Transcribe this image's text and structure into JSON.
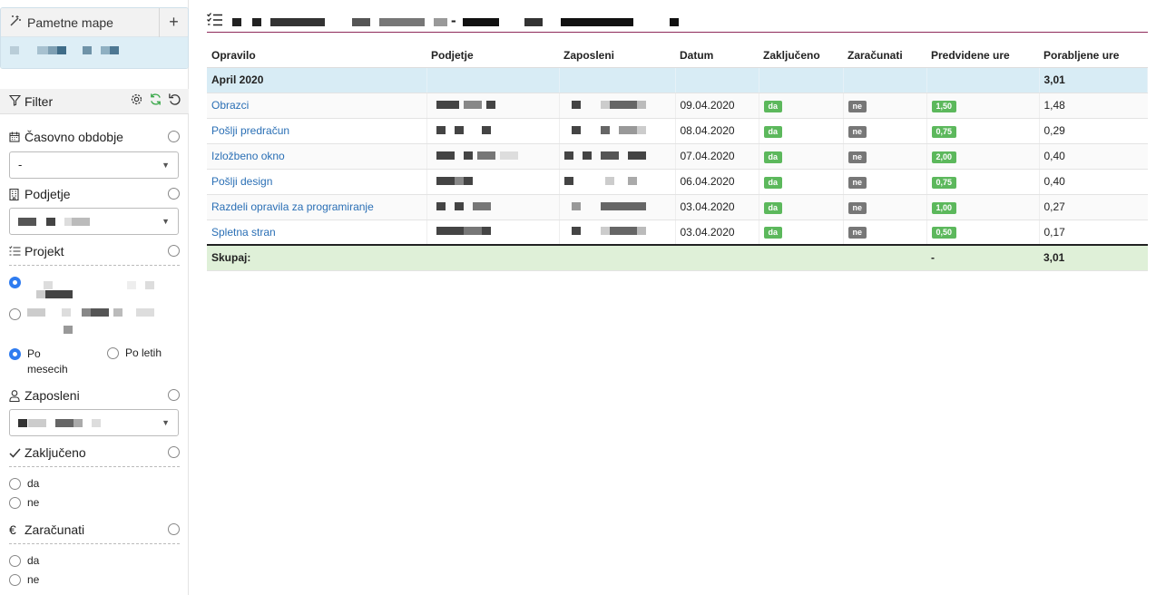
{
  "sidebar": {
    "smart_maps": {
      "title": "Pametne mape",
      "add_label": "+"
    },
    "filter": {
      "title": "Filter"
    },
    "sections": {
      "period": {
        "title": "Časovno obdobje",
        "select_value": "-"
      },
      "company": {
        "title": "Podjetje"
      },
      "project": {
        "title": "Projekt",
        "opt_month": "Po mesecih",
        "opt_year": "Po letih"
      },
      "employee": {
        "title": "Zaposleni"
      },
      "closed": {
        "title": "Zaključeno",
        "opt_yes": "da",
        "opt_no": "ne"
      },
      "billed": {
        "title": "Zaračunati",
        "opt_yes": "da",
        "opt_no": "ne"
      }
    }
  },
  "main": {
    "title_separator": "-",
    "columns": [
      "Opravilo",
      "Podjetje",
      "Zaposleni",
      "Datum",
      "Zaključeno",
      "Zaračunati",
      "Predvidene ure",
      "Porabljene ure"
    ],
    "group": {
      "label": "April 2020",
      "spent": "3,01"
    },
    "rows": [
      {
        "task": "Obrazci",
        "date": "09.04.2020",
        "closed": "da",
        "billed": "ne",
        "planned": "1,50",
        "spent": "1,48"
      },
      {
        "task": "Pošlji predračun",
        "date": "08.04.2020",
        "closed": "da",
        "billed": "ne",
        "planned": "0,75",
        "spent": "0,29"
      },
      {
        "task": "Izložbeno okno",
        "date": "07.04.2020",
        "closed": "da",
        "billed": "ne",
        "planned": "2,00",
        "spent": "0,40"
      },
      {
        "task": "Pošlji design",
        "date": "06.04.2020",
        "closed": "da",
        "billed": "ne",
        "planned": "0,75",
        "spent": "0,40"
      },
      {
        "task": "Razdeli opravila za programiranje",
        "date": "03.04.2020",
        "closed": "da",
        "billed": "ne",
        "planned": "1,00",
        "spent": "0,27"
      },
      {
        "task": "Spletna stran",
        "date": "03.04.2020",
        "closed": "da",
        "billed": "ne",
        "planned": "0,50",
        "spent": "0,17"
      }
    ],
    "total": {
      "label": "Skupaj:",
      "planned": "-",
      "spent": "3,01"
    }
  },
  "colors": {
    "accent": "#2f7cf0",
    "link": "#2a6fb5",
    "badge_green": "#5cb85c",
    "badge_grey": "#777777",
    "group_bg": "#d8ecf5",
    "total_bg": "#dff0d8",
    "title_underline": "#8e2a5a"
  },
  "icons": [
    "magic-wand-icon",
    "plus-icon",
    "filter-icon",
    "gear-icon",
    "refresh-icon",
    "undo-icon",
    "calendar-icon",
    "building-icon",
    "list-icon",
    "user-icon",
    "check-icon",
    "euro-icon",
    "checklist-icon"
  ]
}
